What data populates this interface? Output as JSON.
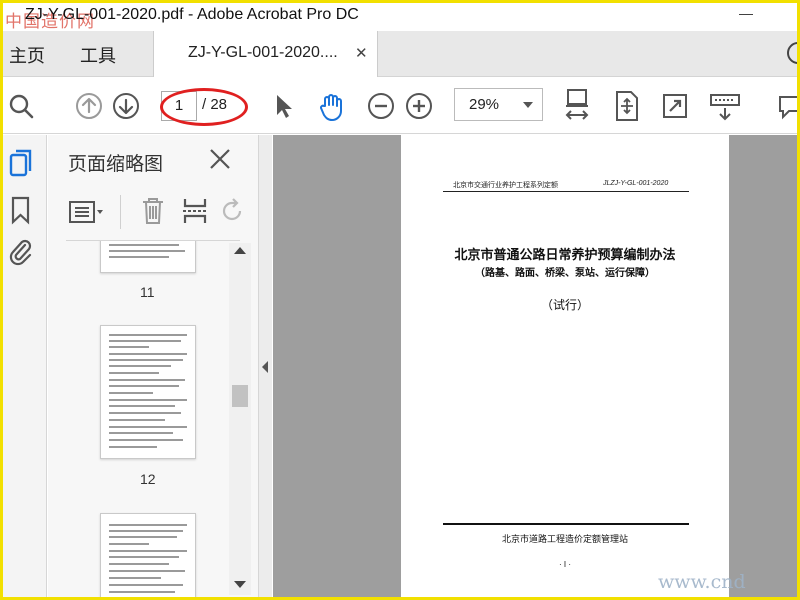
{
  "window": {
    "title": "ZJ-Y-GL-001-2020.pdf - Adobe Acrobat Pro DC",
    "overlay_watermark": "中国造价网"
  },
  "tabs": {
    "home": "主页",
    "tools": "工具",
    "document": "ZJ-Y-GL-001-2020...."
  },
  "toolbar": {
    "current_page": "1",
    "total_pages": "/ 28",
    "zoom": "29%",
    "highlight_color": "#e02020"
  },
  "panel": {
    "title": "页面缩略图",
    "thumbnails": [
      {
        "label": "11"
      },
      {
        "label": "12"
      },
      {
        "label": ""
      }
    ]
  },
  "page": {
    "header_left": "北京市交通行业养护工程系列定额",
    "header_right": "JLZJ-Y-GL-001-2020",
    "title": "北京市普通公路日常养护预算编制办法",
    "subtitle": "（路基、路面、桥梁、泵站、运行保障）",
    "trial": "（试行）",
    "organization": "北京市道路工程造价定额管理站",
    "page_number": "· I ·"
  },
  "watermark": "www.cnd",
  "colors": {
    "frame": "#f2e000",
    "accent_blue": "#1a73d9",
    "doc_background": "#9e9e9e"
  }
}
